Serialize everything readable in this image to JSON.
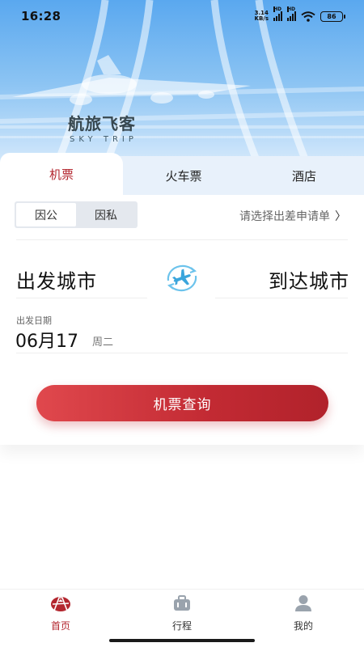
{
  "status_bar": {
    "time": "16:28",
    "net_speed_value": "3.14",
    "net_speed_unit": "KB/s",
    "hd": "HD",
    "battery": "86"
  },
  "brand": {
    "name": "航旅飞客",
    "slogan": "SKY TRIP"
  },
  "tabs": [
    {
      "label": "机票",
      "active": true
    },
    {
      "label": "火车票",
      "active": false
    },
    {
      "label": "酒店",
      "active": false
    }
  ],
  "trip_type": {
    "options": [
      "因公",
      "因私"
    ],
    "selected": "因公"
  },
  "apply_link": "请选择出差申请单",
  "route": {
    "from": "出发城市",
    "to": "到达城市"
  },
  "date": {
    "label": "出发日期",
    "value": "06月17",
    "weekday": "周二"
  },
  "search_button": "机票查询",
  "bottom_nav": [
    {
      "label": "首页",
      "icon": "home-icon",
      "active": true
    },
    {
      "label": "行程",
      "icon": "suitcase-icon",
      "active": false
    },
    {
      "label": "我的",
      "icon": "user-icon",
      "active": false
    }
  ],
  "colors": {
    "accent": "#b3262e",
    "button_start": "#e0484d",
    "button_end": "#b1222b",
    "hero_top": "#5aa8ef"
  }
}
